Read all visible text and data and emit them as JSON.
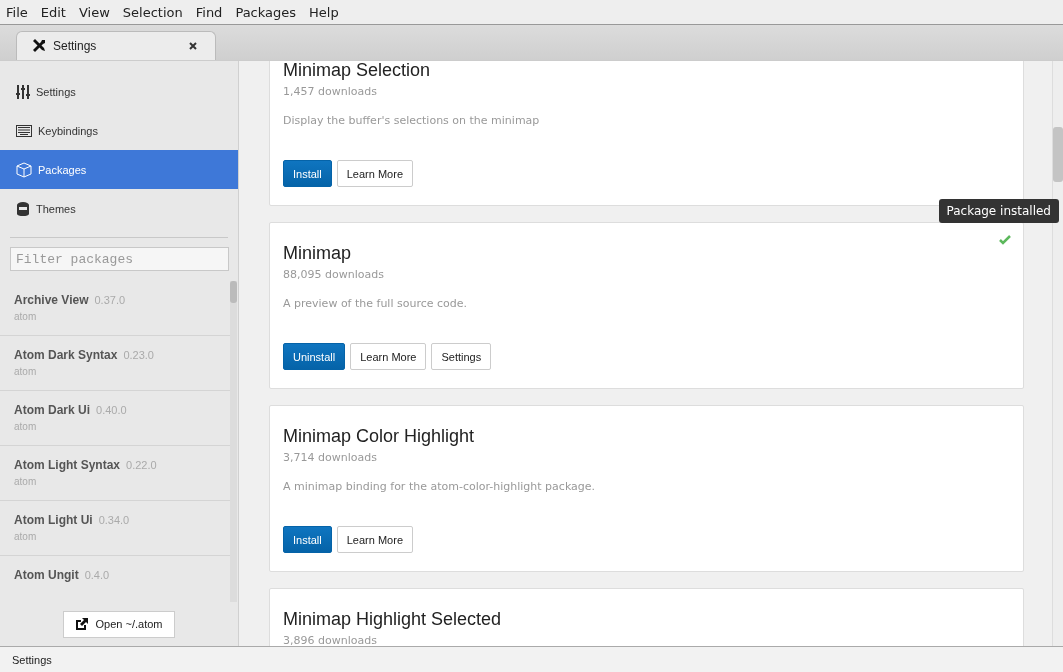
{
  "menu": [
    "File",
    "Edit",
    "View",
    "Selection",
    "Find",
    "Packages",
    "Help"
  ],
  "tabs": [
    {
      "label": "Settings",
      "selected": true
    }
  ],
  "sidebar": {
    "items": [
      {
        "label": "Settings",
        "kind": "sliders",
        "selected": false
      },
      {
        "label": "Keybindings",
        "kind": "keyboard",
        "selected": false
      },
      {
        "label": "Packages",
        "kind": "package",
        "selected": true
      },
      {
        "label": "Themes",
        "kind": "bucket",
        "selected": false
      }
    ],
    "filter": {
      "placeholder": "Filter packages"
    },
    "packages": [
      {
        "name": "Archive View",
        "version": "0.37.0",
        "author": "atom"
      },
      {
        "name": "Atom Dark Syntax",
        "version": "0.23.0",
        "author": "atom"
      },
      {
        "name": "Atom Dark Ui",
        "version": "0.40.0",
        "author": "atom"
      },
      {
        "name": "Atom Light Syntax",
        "version": "0.22.0",
        "author": "atom"
      },
      {
        "name": "Atom Light Ui",
        "version": "0.34.0",
        "author": "atom"
      },
      {
        "name": "Atom Ungit",
        "version": "0.4.0"
      }
    ],
    "open_button": "Open ~/.atom"
  },
  "cards": [
    {
      "title": "Minimap Selection",
      "downloads": "1,457 downloads",
      "description": "Display the buffer's selections on the minimap",
      "installed": false,
      "buttons": [
        {
          "label": "Install",
          "kind": "primary"
        },
        {
          "label": "Learn More",
          "kind": "default"
        }
      ]
    },
    {
      "title": "Minimap",
      "downloads": "88,095 downloads",
      "description": "A preview of the full source code.",
      "installed": true,
      "buttons": [
        {
          "label": "Uninstall",
          "kind": "primary"
        },
        {
          "label": "Learn More",
          "kind": "default"
        },
        {
          "label": "Settings",
          "kind": "default"
        }
      ]
    },
    {
      "title": "Minimap Color Highlight",
      "downloads": "3,714 downloads",
      "description": "A minimap binding for the atom-color-highlight package.",
      "installed": false,
      "buttons": [
        {
          "label": "Install",
          "kind": "primary"
        },
        {
          "label": "Learn More",
          "kind": "default"
        }
      ]
    },
    {
      "title": "Minimap Highlight Selected",
      "downloads": "3,896 downloads"
    }
  ],
  "tooltip": "Package installed",
  "status_bar": "Settings"
}
